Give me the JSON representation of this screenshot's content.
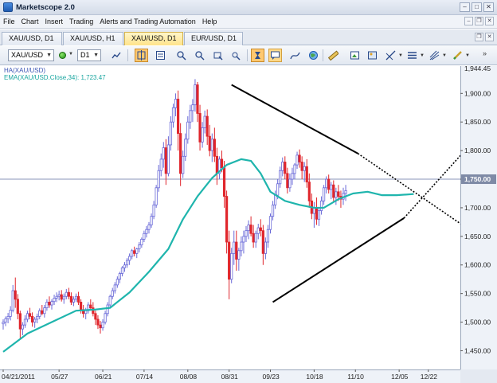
{
  "window": {
    "title": "Marketscope 2.0"
  },
  "menu": [
    "File",
    "Chart",
    "Insert",
    "Trading",
    "Alerts and Trading Automation",
    "Help"
  ],
  "tabs": [
    {
      "label": "XAU/USD, D1",
      "active": false
    },
    {
      "label": "XAU/USD, H1",
      "active": false
    },
    {
      "label": "XAU/USD, D1",
      "active": true
    },
    {
      "label": "EUR/USD, D1",
      "active": false
    }
  ],
  "toolbar": {
    "symbol": "XAU/USD",
    "timeframe": "D1"
  },
  "legend": {
    "ha": "HA(XAU/USD)",
    "ema": "EMA(XAU/USD.Close,34): 1,723.47"
  },
  "colors": {
    "bull": "#6a6ad8",
    "bear": "#e0262c",
    "ema": "#1fb5ad",
    "trend": "#000000",
    "price_line": "#8a94b8",
    "price_label_bg": "#7e8aa6"
  },
  "chart_data": {
    "type": "candlestick",
    "symbol": "XAU/USD",
    "timeframe": "D1",
    "y_axis_ticks": [
      1450,
      1500,
      1550,
      1600,
      1650,
      1700,
      1750,
      1800,
      1850,
      1900
    ],
    "y_axis_labels": [
      "1,450.00",
      "1,500.00",
      "1,550.00",
      "1,600.00",
      "1,650.00",
      "1,700.00",
      "1,750.00",
      "1,800.00",
      "1,850.00",
      "1,900.00"
    ],
    "top_label": "1,944.45",
    "current_price_label": "1,750.00",
    "current_price": 1750,
    "ylim": [
      1420,
      1945
    ],
    "x_axis_labels": [
      "04/21/2011",
      "05/27",
      "06/21",
      "07/14",
      "08/08",
      "08/31",
      "09/23",
      "10/18",
      "11/10",
      "12/05",
      "12/22"
    ],
    "x_axis_label_index": [
      0,
      23,
      41,
      58,
      76,
      93,
      110,
      128,
      145,
      163,
      175
    ],
    "candles": [
      [
        1497,
        1505,
        1487,
        1500
      ],
      [
        1500,
        1510,
        1493,
        1506
      ],
      [
        1506,
        1516,
        1498,
        1510
      ],
      [
        1510,
        1528,
        1503,
        1521
      ],
      [
        1521,
        1565,
        1517,
        1555
      ],
      [
        1555,
        1578,
        1525,
        1540
      ],
      [
        1540,
        1549,
        1505,
        1515
      ],
      [
        1515,
        1520,
        1472,
        1488
      ],
      [
        1488,
        1500,
        1477,
        1495
      ],
      [
        1495,
        1512,
        1490,
        1505
      ],
      [
        1505,
        1520,
        1500,
        1515
      ],
      [
        1515,
        1525,
        1505,
        1510
      ],
      [
        1510,
        1517,
        1492,
        1500
      ],
      [
        1500,
        1509,
        1490,
        1505
      ],
      [
        1505,
        1515,
        1498,
        1510
      ],
      [
        1510,
        1524,
        1505,
        1520
      ],
      [
        1520,
        1530,
        1512,
        1515
      ],
      [
        1515,
        1530,
        1508,
        1525
      ],
      [
        1525,
        1540,
        1520,
        1535
      ],
      [
        1535,
        1545,
        1525,
        1530
      ],
      [
        1530,
        1540,
        1522,
        1536
      ],
      [
        1536,
        1548,
        1530,
        1542
      ],
      [
        1542,
        1552,
        1535,
        1545
      ],
      [
        1545,
        1555,
        1538,
        1548
      ],
      [
        1548,
        1556,
        1536,
        1540
      ],
      [
        1540,
        1550,
        1532,
        1545
      ],
      [
        1545,
        1558,
        1540,
        1552
      ],
      [
        1552,
        1560,
        1540,
        1545
      ],
      [
        1545,
        1552,
        1530,
        1535
      ],
      [
        1535,
        1545,
        1528,
        1540
      ],
      [
        1540,
        1550,
        1535,
        1545
      ],
      [
        1545,
        1553,
        1530,
        1535
      ],
      [
        1535,
        1540,
        1515,
        1522
      ],
      [
        1522,
        1530,
        1508,
        1515
      ],
      [
        1515,
        1525,
        1505,
        1520
      ],
      [
        1520,
        1535,
        1515,
        1530
      ],
      [
        1530,
        1540,
        1520,
        1525
      ],
      [
        1525,
        1535,
        1510,
        1515
      ],
      [
        1515,
        1520,
        1495,
        1505
      ],
      [
        1505,
        1512,
        1488,
        1495
      ],
      [
        1495,
        1502,
        1480,
        1490
      ],
      [
        1490,
        1505,
        1485,
        1500
      ],
      [
        1500,
        1520,
        1496,
        1515
      ],
      [
        1515,
        1535,
        1510,
        1530
      ],
      [
        1530,
        1548,
        1525,
        1545
      ],
      [
        1545,
        1560,
        1540,
        1555
      ],
      [
        1555,
        1570,
        1550,
        1565
      ],
      [
        1565,
        1580,
        1560,
        1575
      ],
      [
        1575,
        1588,
        1568,
        1585
      ],
      [
        1585,
        1598,
        1580,
        1595
      ],
      [
        1595,
        1605,
        1588,
        1600
      ],
      [
        1600,
        1612,
        1595,
        1608
      ],
      [
        1608,
        1620,
        1600,
        1615
      ],
      [
        1615,
        1628,
        1610,
        1625
      ],
      [
        1625,
        1632,
        1615,
        1620
      ],
      [
        1620,
        1630,
        1612,
        1628
      ],
      [
        1628,
        1640,
        1622,
        1635
      ],
      [
        1635,
        1648,
        1630,
        1645
      ],
      [
        1645,
        1660,
        1640,
        1655
      ],
      [
        1655,
        1668,
        1648,
        1662
      ],
      [
        1662,
        1675,
        1655,
        1670
      ],
      [
        1670,
        1690,
        1665,
        1685
      ],
      [
        1685,
        1712,
        1680,
        1705
      ],
      [
        1705,
        1740,
        1700,
        1735
      ],
      [
        1735,
        1775,
        1728,
        1765
      ],
      [
        1765,
        1795,
        1755,
        1785
      ],
      [
        1785,
        1815,
        1770,
        1805
      ],
      [
        1805,
        1820,
        1740,
        1760
      ],
      [
        1760,
        1825,
        1755,
        1810
      ],
      [
        1810,
        1860,
        1800,
        1850
      ],
      [
        1850,
        1882,
        1840,
        1875
      ],
      [
        1875,
        1900,
        1860,
        1890
      ],
      [
        1890,
        1905,
        1800,
        1830
      ],
      [
        1830,
        1848,
        1738,
        1760
      ],
      [
        1760,
        1800,
        1752,
        1790
      ],
      [
        1790,
        1830,
        1782,
        1820
      ],
      [
        1820,
        1860,
        1812,
        1850
      ],
      [
        1850,
        1880,
        1838,
        1870
      ],
      [
        1870,
        1890,
        1850,
        1880
      ],
      [
        1880,
        1925,
        1868,
        1915
      ],
      [
        1915,
        1920,
        1850,
        1865
      ],
      [
        1865,
        1880,
        1800,
        1815
      ],
      [
        1815,
        1850,
        1805,
        1840
      ],
      [
        1840,
        1870,
        1830,
        1860
      ],
      [
        1860,
        1872,
        1810,
        1825
      ],
      [
        1825,
        1845,
        1790,
        1800
      ],
      [
        1800,
        1830,
        1780,
        1820
      ],
      [
        1820,
        1840,
        1780,
        1790
      ],
      [
        1790,
        1805,
        1740,
        1760
      ],
      [
        1760,
        1790,
        1750,
        1785
      ],
      [
        1785,
        1800,
        1762,
        1770
      ],
      [
        1770,
        1782,
        1700,
        1720
      ],
      [
        1720,
        1730,
        1620,
        1640
      ],
      [
        1640,
        1660,
        1540,
        1575
      ],
      [
        1575,
        1630,
        1568,
        1620
      ],
      [
        1620,
        1660,
        1600,
        1640
      ],
      [
        1640,
        1660,
        1590,
        1610
      ],
      [
        1610,
        1630,
        1590,
        1625
      ],
      [
        1625,
        1650,
        1615,
        1640
      ],
      [
        1640,
        1660,
        1620,
        1650
      ],
      [
        1650,
        1668,
        1640,
        1660
      ],
      [
        1660,
        1678,
        1645,
        1670
      ],
      [
        1670,
        1685,
        1650,
        1655
      ],
      [
        1655,
        1670,
        1630,
        1640
      ],
      [
        1640,
        1660,
        1630,
        1655
      ],
      [
        1655,
        1672,
        1645,
        1665
      ],
      [
        1665,
        1680,
        1650,
        1660
      ],
      [
        1660,
        1670,
        1600,
        1620
      ],
      [
        1620,
        1648,
        1610,
        1640
      ],
      [
        1640,
        1670,
        1630,
        1662
      ],
      [
        1662,
        1690,
        1655,
        1685
      ],
      [
        1685,
        1712,
        1678,
        1705
      ],
      [
        1705,
        1730,
        1698,
        1722
      ],
      [
        1722,
        1750,
        1715,
        1742
      ],
      [
        1742,
        1772,
        1735,
        1765
      ],
      [
        1765,
        1788,
        1755,
        1780
      ],
      [
        1780,
        1790,
        1750,
        1760
      ],
      [
        1760,
        1770,
        1725,
        1735
      ],
      [
        1735,
        1760,
        1728,
        1750
      ],
      [
        1750,
        1770,
        1740,
        1760
      ],
      [
        1760,
        1778,
        1750,
        1775
      ],
      [
        1775,
        1798,
        1768,
        1792
      ],
      [
        1792,
        1802,
        1770,
        1780
      ],
      [
        1780,
        1790,
        1750,
        1765
      ],
      [
        1765,
        1780,
        1745,
        1772
      ],
      [
        1772,
        1785,
        1735,
        1745
      ],
      [
        1745,
        1760,
        1700,
        1712
      ],
      [
        1712,
        1725,
        1680,
        1690
      ],
      [
        1690,
        1710,
        1665,
        1700
      ],
      [
        1700,
        1718,
        1670,
        1680
      ],
      [
        1680,
        1700,
        1668,
        1695
      ],
      [
        1695,
        1720,
        1688,
        1712
      ],
      [
        1712,
        1740,
        1705,
        1735
      ],
      [
        1735,
        1755,
        1725,
        1750
      ],
      [
        1750,
        1758,
        1725,
        1732
      ],
      [
        1732,
        1745,
        1715,
        1740
      ],
      [
        1740,
        1748,
        1710,
        1718
      ],
      [
        1718,
        1735,
        1705,
        1728
      ],
      [
        1728,
        1740,
        1712,
        1720
      ],
      [
        1720,
        1730,
        1700,
        1715
      ],
      [
        1715,
        1735,
        1705,
        1725
      ],
      [
        1725,
        1740,
        1712,
        1730
      ]
    ],
    "ema": [
      [
        0,
        1448
      ],
      [
        10,
        1480
      ],
      [
        20,
        1500
      ],
      [
        30,
        1520
      ],
      [
        38,
        1522
      ],
      [
        44,
        1525
      ],
      [
        52,
        1552
      ],
      [
        60,
        1588
      ],
      [
        68,
        1628
      ],
      [
        74,
        1680
      ],
      [
        80,
        1720
      ],
      [
        86,
        1752
      ],
      [
        92,
        1775
      ],
      [
        98,
        1785
      ],
      [
        102,
        1782
      ],
      [
        106,
        1760
      ],
      [
        110,
        1728
      ],
      [
        116,
        1712
      ],
      [
        122,
        1705
      ],
      [
        128,
        1700
      ],
      [
        132,
        1700
      ],
      [
        138,
        1715
      ],
      [
        144,
        1725
      ],
      [
        150,
        1728
      ],
      [
        156,
        1722
      ],
      [
        162,
        1722
      ],
      [
        169,
        1724
      ]
    ],
    "trendlines": [
      {
        "style": "solid",
        "from": [
          94,
          1915
        ],
        "to": [
          146,
          1795
        ]
      },
      {
        "style": "dotted",
        "from": [
          146,
          1795
        ],
        "to": [
          189,
          1670
        ]
      },
      {
        "style": "solid",
        "from": [
          111,
          1535
        ],
        "to": [
          165,
          1682
        ]
      },
      {
        "style": "dotted",
        "from": [
          165,
          1682
        ],
        "to": [
          189,
          1795
        ]
      }
    ]
  }
}
